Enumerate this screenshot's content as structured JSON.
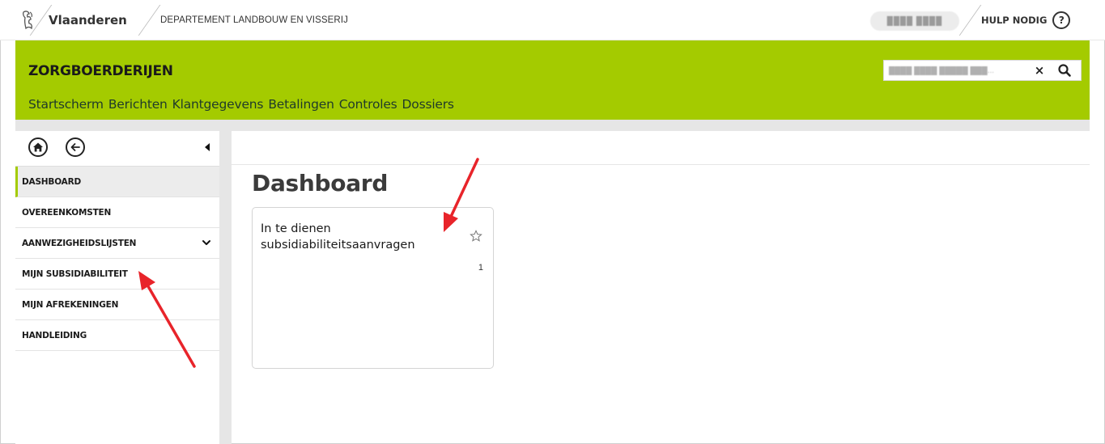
{
  "topbar": {
    "brand": "Vlaanderen",
    "department": "DEPARTEMENT LANDBOUW EN VISSERIJ",
    "user": "████ ████",
    "help_label": "HULP NODIG",
    "help_symbol": "?"
  },
  "header": {
    "app_title": "ZORGBOERDERIJEN",
    "search_value": "████ ████ █████ ███...",
    "clear_symbol": "×",
    "nav": [
      "Startscherm",
      "Berichten",
      "Klantgegevens",
      "Betalingen",
      "Controles",
      "Dossiers"
    ],
    "accent_color": "#a4cb00"
  },
  "sidebar": {
    "items": [
      {
        "label": "DASHBOARD",
        "active": true
      },
      {
        "label": "OVEREENKOMSTEN"
      },
      {
        "label": "AANWEZIGHEIDSLIJSTEN",
        "expandable": true
      },
      {
        "label": "MIJN SUBSIDIABILITEIT"
      },
      {
        "label": "MIJN AFREKENINGEN"
      },
      {
        "label": "HANDLEIDING"
      }
    ],
    "icons": [
      "home-icon",
      "back-arrow-icon",
      "collapse-caret-icon",
      "chevron-down-icon"
    ]
  },
  "main": {
    "title": "Dashboard",
    "card": {
      "title": "In te dienen subsidiabiliteitsaanvragen",
      "count": "1",
      "icon": "star-outline-icon"
    }
  },
  "annotation_color": "#e8242a"
}
